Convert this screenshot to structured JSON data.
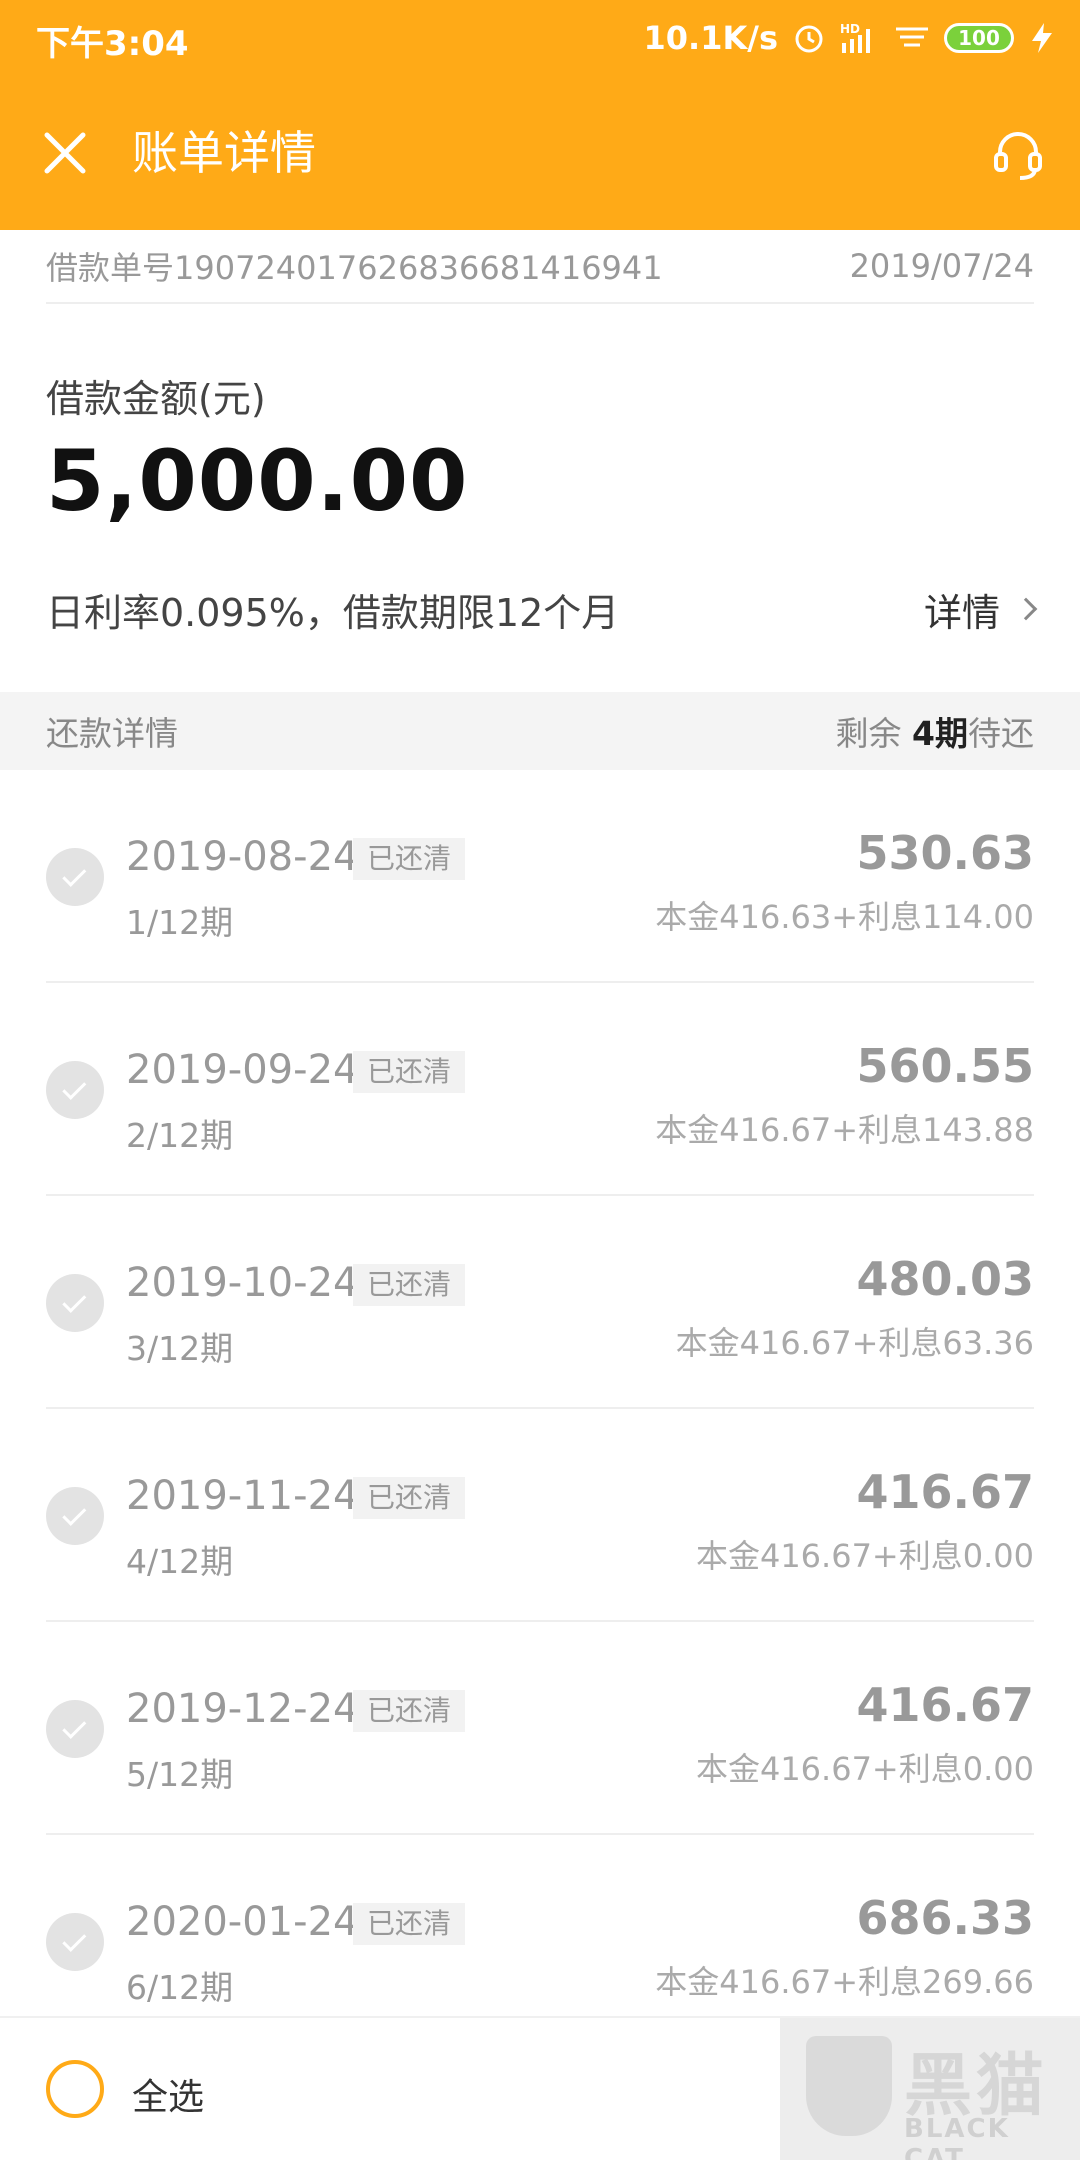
{
  "status_bar": {
    "time": "下午3:04",
    "net_speed": "10.1K/s",
    "battery": "100",
    "hd_label": "HD"
  },
  "header": {
    "title": "账单详情"
  },
  "loan": {
    "loan_no": "借款单号19072401762683668141694​1",
    "loan_date": "2019/07/24",
    "amount_label": "借款金额(元)",
    "amount": "5,000.00",
    "rate_text": "日利率0.095%，借款期限12个月",
    "detail_link": "详情"
  },
  "repayment": {
    "section_label": "还款详情",
    "remain_prefix": "剩余 ",
    "remain_count": "4期",
    "remain_suffix": "待还",
    "items": [
      {
        "date": "2019-08-24",
        "status": "已还清",
        "period": "1/12期",
        "amount": "530.63",
        "breakdown": "本金416.63+利息114.00"
      },
      {
        "date": "2019-09-24",
        "status": "已还清",
        "period": "2/12期",
        "amount": "560.55",
        "breakdown": "本金416.67+利息143.88"
      },
      {
        "date": "2019-10-24",
        "status": "已还清",
        "period": "3/12期",
        "amount": "480.03",
        "breakdown": "本金416.67+利息63.36"
      },
      {
        "date": "2019-11-24",
        "status": "已还清",
        "period": "4/12期",
        "amount": "416.67",
        "breakdown": "本金416.67+利息0.00"
      },
      {
        "date": "2019-12-24",
        "status": "已还清",
        "period": "5/12期",
        "amount": "416.67",
        "breakdown": "本金416.67+利息0.00"
      },
      {
        "date": "2020-01-24",
        "status": "已还清",
        "period": "6/12期",
        "amount": "686.33",
        "breakdown": "本金416.67+利息269.66"
      }
    ]
  },
  "bottom": {
    "select_all": "全选",
    "watermark_cn": "黑猫",
    "watermark_en": "BLACK CAT"
  },
  "colors": {
    "brand": "#FFAA17",
    "paid_gray": "#999999",
    "battery_green": "#7BD13B"
  },
  "icons": [
    "close-icon",
    "headset-icon",
    "alarm-icon",
    "signal-icon",
    "wifi-icon",
    "battery-icon",
    "charging-icon",
    "chevron-right-icon",
    "check-icon"
  ]
}
